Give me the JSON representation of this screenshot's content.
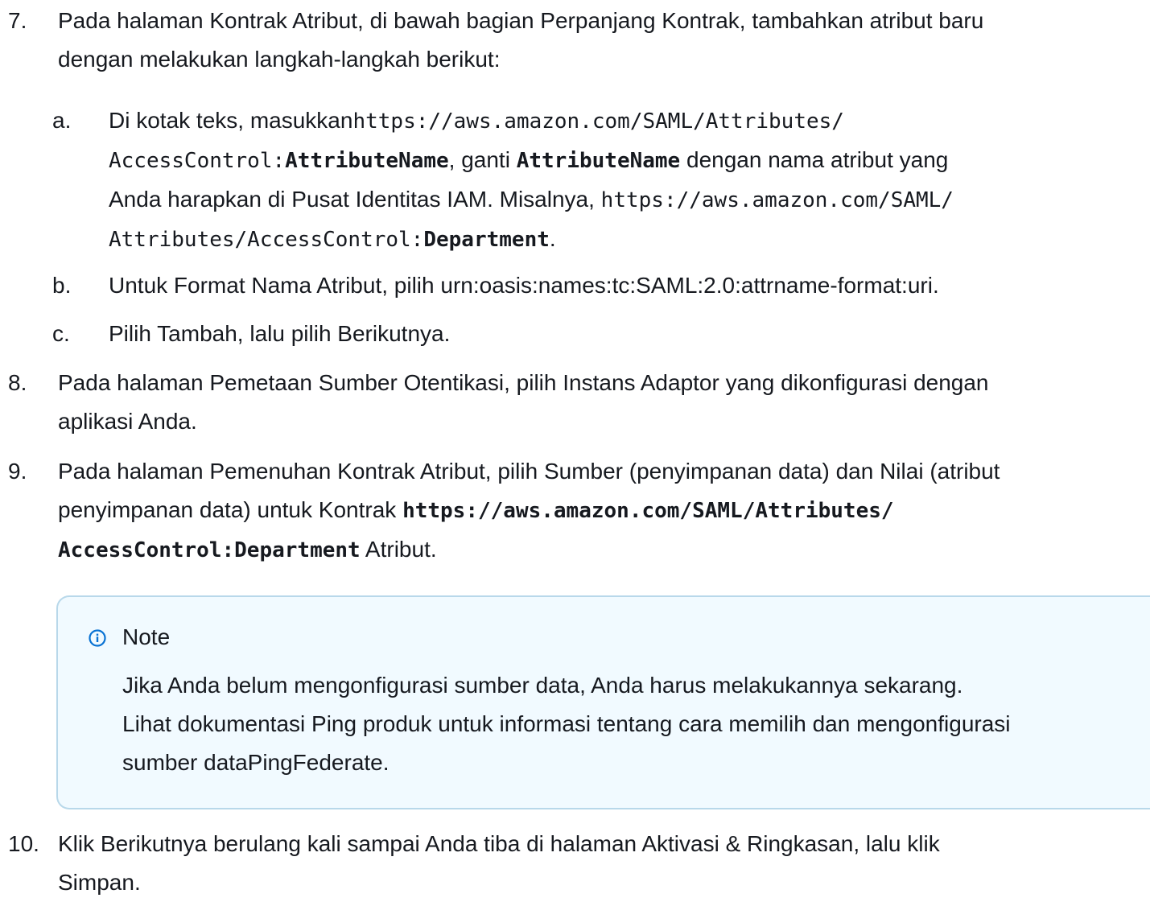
{
  "steps": {
    "s7": {
      "num": "7.",
      "line1": "Pada halaman Kontrak Atribut, di bawah bagian Perpanjang Kontrak, tambahkan atribut baru",
      "line2": "dengan melakukan langkah-langkah berikut:",
      "subs": {
        "a": {
          "letter": "a.",
          "p1": "Di kotak teks, masukkan",
          "code1": "https://aws.amazon.com/SAML/Attributes/",
          "code2": "AccessControl:",
          "code2b": "AttributeName",
          "p2": ", ganti ",
          "code3": "AttributeName",
          "p3": " dengan nama atribut yang",
          "line3": "Anda harapkan di Pusat Identitas IAM. Misalnya, ",
          "code4": "https://aws.amazon.com/SAML/",
          "code5": "Attributes/AccessControl:",
          "code5b": "Department",
          "p4": "."
        },
        "b": {
          "letter": "b.",
          "text": "Untuk Format Nama Atribut, pilih urn:oasis:names:tc:SAML:2.0:attrname-format:uri."
        },
        "c": {
          "letter": "c.",
          "text": "Pilih Tambah, lalu pilih Berikutnya."
        }
      }
    },
    "s8": {
      "num": "8.",
      "line1": "Pada halaman Pemetaan Sumber Otentikasi, pilih Instans Adaptor yang dikonfigurasi dengan",
      "line2": "aplikasi Anda."
    },
    "s9": {
      "num": "9.",
      "line1": "Pada halaman Pemenuhan Kontrak Atribut, pilih Sumber (penyimpanan data) dan Nilai (atribut",
      "line2a": "penyimpanan data) untuk Kontrak ",
      "code1": "https://aws.amazon.com/SAML/Attributes/",
      "code2": "AccessControl:Department",
      "line3b": " Atribut."
    },
    "s10": {
      "num": "10.",
      "line1": "Klik Berikutnya berulang kali sampai Anda tiba di halaman Aktivasi & Ringkasan, lalu klik",
      "line2": "Simpan."
    }
  },
  "note": {
    "icon": "info-icon",
    "title": "Note",
    "line1": "Jika Anda belum mengonfigurasi sumber data, Anda harus melakukannya sekarang.",
    "line2": "Lihat dokumentasi Ping produk untuk informasi tentang cara memilih dan mengonfigurasi",
    "line3": "sumber dataPingFederate.",
    "colors": {
      "background": "#f1faff",
      "border": "#b8d8ea",
      "icon": "#0972d3"
    }
  }
}
